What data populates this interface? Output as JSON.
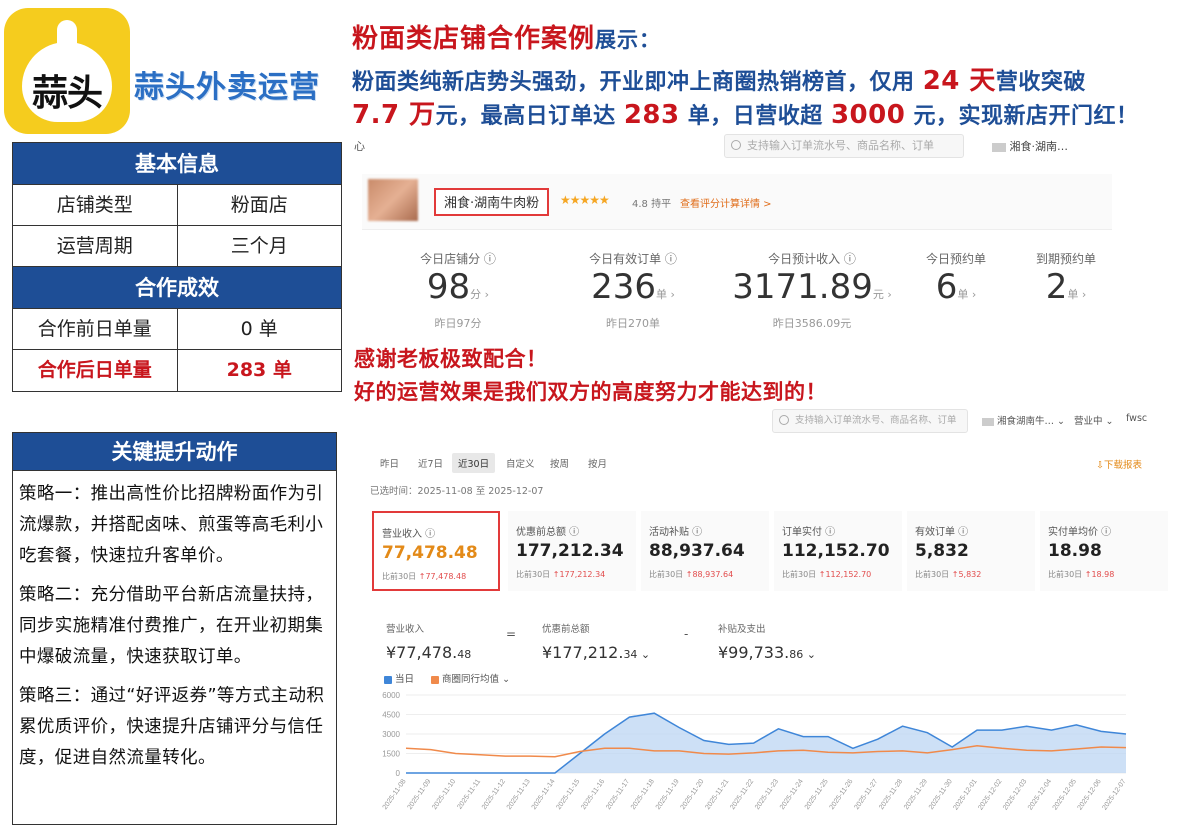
{
  "brand": {
    "logo_text": "蒜头",
    "name": "蒜头外卖运营"
  },
  "headline": {
    "main": "粉面类店铺合作案例",
    "suffix": "展示："
  },
  "summary": {
    "line1_a": "粉面类纯新店势头强劲，开业即冲上商圈热销榜首，仅用",
    "line1_red": "24 天",
    "line1_b": "营收突破",
    "line2_red1": "7.7 万",
    "line2_a": "元，最高日订单达",
    "line2_red2": "283",
    "line2_b": "单，日营收超",
    "line2_red3": "3000",
    "line2_c": "元，实现新店开门红！"
  },
  "basic_info": {
    "title": "基本信息",
    "rows": [
      {
        "label": "店铺类型",
        "value": "粉面店"
      },
      {
        "label": "运营周期",
        "value": "三个月"
      }
    ],
    "result_title": "合作成效",
    "result_rows": [
      {
        "label": "合作前日单量",
        "value": "0 单"
      },
      {
        "label": "合作后日单量",
        "value": "283 单"
      }
    ]
  },
  "strategies": {
    "title": "关键提升动作",
    "items": [
      "策略一：推出高性价比招牌粉面作为引流爆款，并搭配卤味、煎蛋等高毛利小吃套餐，快速拉升客单价。",
      "策略二：充分借助平台新店流量扶持，同步实施精准付费推广，在开业初期集中爆破流量，快速获取订单。",
      "策略三：通过“好评返券”等方式主动积累优质评价，快速提升店铺评分与信任度，促进自然流量转化。"
    ]
  },
  "shot1": {
    "nav_char": "心",
    "search_placeholder": "支持输入订单流水号、商品名称、订单",
    "shop_selector": "湘食·湖南…",
    "shop_name": "湘食·湖南牛肉粉",
    "stars": "★★★★★",
    "score": "4.8 持平",
    "score_link": "查看评分计算详情 >",
    "metrics": [
      {
        "label": "今日店铺分 ⓘ",
        "value": "98",
        "unit": "分 ›",
        "sub": "昨日97分"
      },
      {
        "label": "今日有效订单 ⓘ",
        "value": "236",
        "unit": "单 ›",
        "sub": "昨日270单"
      },
      {
        "label": "今日预计收入 ⓘ",
        "value": "3171.89",
        "unit": "元 ›",
        "sub": "昨日3586.09元"
      },
      {
        "label": "今日预约单",
        "value": "6",
        "unit": "单 ›",
        "sub": ""
      },
      {
        "label": "到期预约单",
        "value": "2",
        "unit": "单 ›",
        "sub": ""
      }
    ]
  },
  "thanks": {
    "line1": "感谢老板极致配合！",
    "line2": "好的运营效果是我们双方的高度努力才能达到的！"
  },
  "shot2": {
    "search_placeholder": "支持输入订单流水号、商品名称、订单",
    "shop_selector": "湘食湖南牛… ⌄",
    "status": "营业中 ⌄",
    "user": "fwsc",
    "tabs": [
      "昨日",
      "近7日",
      "近30日",
      "自定义",
      "按周",
      "按月"
    ],
    "active_tab": "近30日",
    "download": "下载报表",
    "range_label": "已选时间：2025-11-08 至 2025-12-07",
    "kpis": [
      {
        "label": "营业收入 ⓘ",
        "value": "77,478.48",
        "compare_prefix": "比前30日",
        "compare": "↑77,478.48"
      },
      {
        "label": "优惠前总额 ⓘ",
        "value": "177,212.34",
        "compare_prefix": "比前30日",
        "compare": "↑177,212.34"
      },
      {
        "label": "活动补贴 ⓘ",
        "value": "88,937.64",
        "compare_prefix": "比前30日",
        "compare": "↑88,937.64"
      },
      {
        "label": "订单实付 ⓘ",
        "value": "112,152.70",
        "compare_prefix": "比前30日",
        "compare": "↑112,152.70"
      },
      {
        "label": "有效订单 ⓘ",
        "value": "5,832",
        "compare_prefix": "比前30日",
        "compare": "↑5,832"
      },
      {
        "label": "实付单均价 ⓘ",
        "value": "18.98",
        "compare_prefix": "比前30日",
        "compare": "↑18.98"
      }
    ],
    "formula": [
      {
        "label": "营业收入",
        "value": "¥77,478.",
        "decimals": "48"
      },
      {
        "label": "优惠前总额",
        "value": "¥177,212.",
        "decimals": "34 ⌄"
      },
      {
        "label": "补贴及支出",
        "value": "¥99,733.",
        "decimals": "86 ⌄"
      }
    ],
    "formula_ops": [
      "=",
      "-"
    ],
    "legend": [
      {
        "name": "当日",
        "color": "#3f86d8"
      },
      {
        "name": "商圈同行均值 ⌄",
        "color": "#f08a4b"
      }
    ]
  },
  "chart_data": {
    "type": "area",
    "x": [
      "2025-11-08",
      "2025-11-09",
      "2025-11-10",
      "2025-11-11",
      "2025-11-12",
      "2025-11-13",
      "2025-11-14",
      "2025-11-15",
      "2025-11-16",
      "2025-11-17",
      "2025-11-18",
      "2025-11-19",
      "2025-11-20",
      "2025-11-21",
      "2025-11-22",
      "2025-11-23",
      "2025-11-24",
      "2025-11-25",
      "2025-11-26",
      "2025-11-27",
      "2025-11-28",
      "2025-11-29",
      "2025-11-30",
      "2025-12-01",
      "2025-12-02",
      "2025-12-03",
      "2025-12-04",
      "2025-12-05",
      "2025-12-06",
      "2025-12-07"
    ],
    "series": [
      {
        "name": "当日",
        "color": "#3f86d8",
        "values": [
          0,
          0,
          0,
          0,
          0,
          0,
          0,
          1500,
          3000,
          4300,
          4600,
          3500,
          2500,
          2200,
          2300,
          3400,
          2800,
          2800,
          1900,
          2600,
          3600,
          3100,
          2000,
          3300,
          3300,
          3600,
          3300,
          3700,
          3200,
          3000
        ]
      },
      {
        "name": "商圈同行均值",
        "color": "#f08a4b",
        "values": [
          1900,
          1800,
          1500,
          1400,
          1300,
          1300,
          1250,
          1650,
          1900,
          1900,
          1700,
          1700,
          1500,
          1450,
          1550,
          1700,
          1750,
          1600,
          1550,
          1650,
          1700,
          1550,
          1800,
          2100,
          1900,
          1750,
          1700,
          1850,
          2000,
          1950
        ]
      }
    ],
    "yticks": [
      0,
      1500,
      3000,
      4500,
      6000
    ],
    "ylim": [
      0,
      6000
    ]
  }
}
